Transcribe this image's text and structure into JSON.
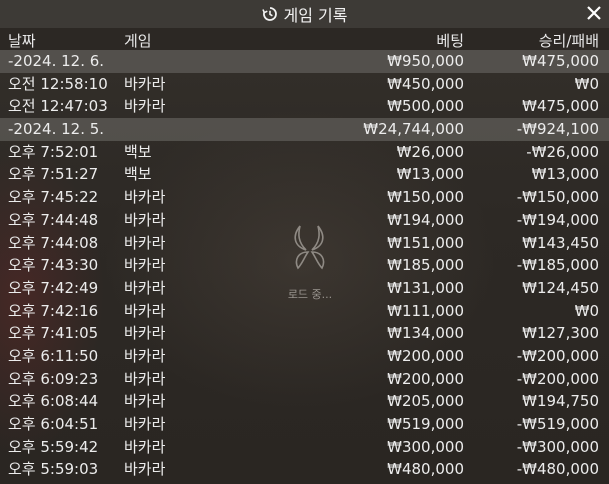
{
  "window": {
    "title": "게임 기록"
  },
  "header": {
    "date": "날짜",
    "game": "게임",
    "bet": "베팅",
    "result": "승리/패배"
  },
  "loading": {
    "text": "로드 중..."
  },
  "rows": [
    {
      "type": "date",
      "time": "-2024. 12. 6.",
      "game": "",
      "bet": "₩950,000",
      "result": "₩475,000"
    },
    {
      "type": "entry",
      "time": "오전 12:58:10",
      "game": "바카라",
      "bet": "₩450,000",
      "result": "₩0"
    },
    {
      "type": "entry",
      "time": "오전 12:47:03",
      "game": "바카라",
      "bet": "₩500,000",
      "result": "₩475,000"
    },
    {
      "type": "date",
      "time": "-2024. 12. 5.",
      "game": "",
      "bet": "₩24,744,000",
      "result": "-₩924,100"
    },
    {
      "type": "entry",
      "time": "오후 7:52:01",
      "game": "백보",
      "bet": "₩26,000",
      "result": "-₩26,000"
    },
    {
      "type": "entry",
      "time": "오후 7:51:27",
      "game": "백보",
      "bet": "₩13,000",
      "result": "₩13,000"
    },
    {
      "type": "entry",
      "time": "오후 7:45:22",
      "game": "바카라",
      "bet": "₩150,000",
      "result": "-₩150,000"
    },
    {
      "type": "entry",
      "time": "오후 7:44:48",
      "game": "바카라",
      "bet": "₩194,000",
      "result": "-₩194,000"
    },
    {
      "type": "entry",
      "time": "오후 7:44:08",
      "game": "바카라",
      "bet": "₩151,000",
      "result": "₩143,450"
    },
    {
      "type": "entry",
      "time": "오후 7:43:30",
      "game": "바카라",
      "bet": "₩185,000",
      "result": "-₩185,000"
    },
    {
      "type": "entry",
      "time": "오후 7:42:49",
      "game": "바카라",
      "bet": "₩131,000",
      "result": "₩124,450"
    },
    {
      "type": "entry",
      "time": "오후 7:42:16",
      "game": "바카라",
      "bet": "₩111,000",
      "result": "₩0"
    },
    {
      "type": "entry",
      "time": "오후 7:41:05",
      "game": "바카라",
      "bet": "₩134,000",
      "result": "₩127,300"
    },
    {
      "type": "entry",
      "time": "오후 6:11:50",
      "game": "바카라",
      "bet": "₩200,000",
      "result": "-₩200,000"
    },
    {
      "type": "entry",
      "time": "오후 6:09:23",
      "game": "바카라",
      "bet": "₩200,000",
      "result": "-₩200,000"
    },
    {
      "type": "entry",
      "time": "오후 6:08:44",
      "game": "바카라",
      "bet": "₩205,000",
      "result": "₩194,750"
    },
    {
      "type": "entry",
      "time": "오후 6:04:51",
      "game": "바카라",
      "bet": "₩519,000",
      "result": "-₩519,000"
    },
    {
      "type": "entry",
      "time": "오후 5:59:42",
      "game": "바카라",
      "bet": "₩300,000",
      "result": "-₩300,000"
    },
    {
      "type": "entry",
      "time": "오후 5:59:03",
      "game": "바카라",
      "bet": "₩480,000",
      "result": "-₩480,000"
    }
  ]
}
